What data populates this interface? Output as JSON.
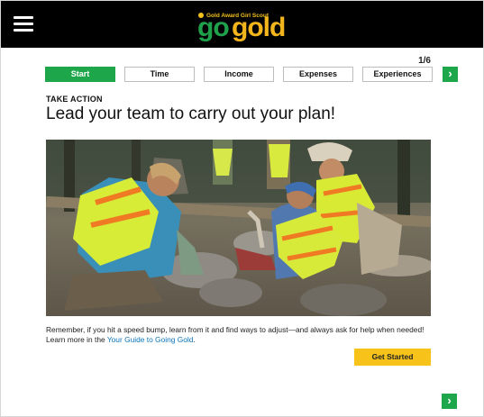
{
  "header": {
    "logo_tagline": "Gold Award Girl Scout",
    "logo_go": "go",
    "logo_gold": "gold"
  },
  "progress": {
    "page_label": "1/6",
    "current_page": 1,
    "total_pages": 6
  },
  "tabs": [
    {
      "label": "Start",
      "active": true
    },
    {
      "label": "Time",
      "active": false
    },
    {
      "label": "Income",
      "active": false
    },
    {
      "label": "Expenses",
      "active": false
    },
    {
      "label": "Experiences",
      "active": false
    }
  ],
  "next_icon": "chevron-right",
  "content": {
    "kicker": "TAKE ACTION",
    "headline": "Lead your team to carry out your plan!",
    "body_prefix": "Remember, if you hit a speed bump, learn from it and find ways to adjust—and always ask for help when needed! Learn more in the ",
    "body_link": "Your Guide to Going Gold",
    "body_suffix": ".",
    "cta_label": "Get Started"
  },
  "colors": {
    "brand_green": "#1ea64b",
    "brand_gold": "#f7c31b",
    "link_blue": "#0b76b8",
    "topbar": "#000000"
  }
}
